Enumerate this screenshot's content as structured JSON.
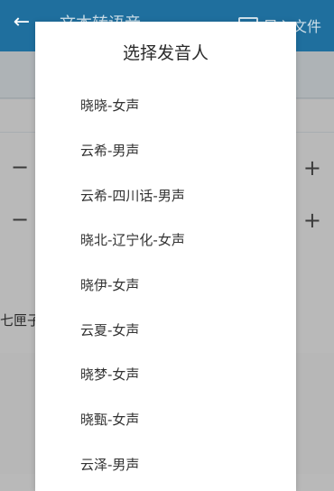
{
  "background": {
    "app_bar": {
      "title": "文本转语音",
      "import_label": "导入文件"
    },
    "subbar": {
      "left_text": "",
      "right_text": ""
    },
    "controls": {
      "minus": "−",
      "plus": "+"
    },
    "left_fragment": "七匣子"
  },
  "dialog": {
    "title": "选择发音人",
    "options": [
      "晓晓-女声",
      "云希-男声",
      "云希-四川话-男声",
      "晓北-辽宁化-女声",
      "晓伊-女声",
      "云夏-女声",
      "晓梦-女声",
      "晓甄-女声",
      "云泽-男声"
    ]
  },
  "colors": {
    "app_bar": "#1f6f9e",
    "overlay": "#b9b9b9",
    "dialog_bg": "#ffffff",
    "text": "#333333"
  }
}
